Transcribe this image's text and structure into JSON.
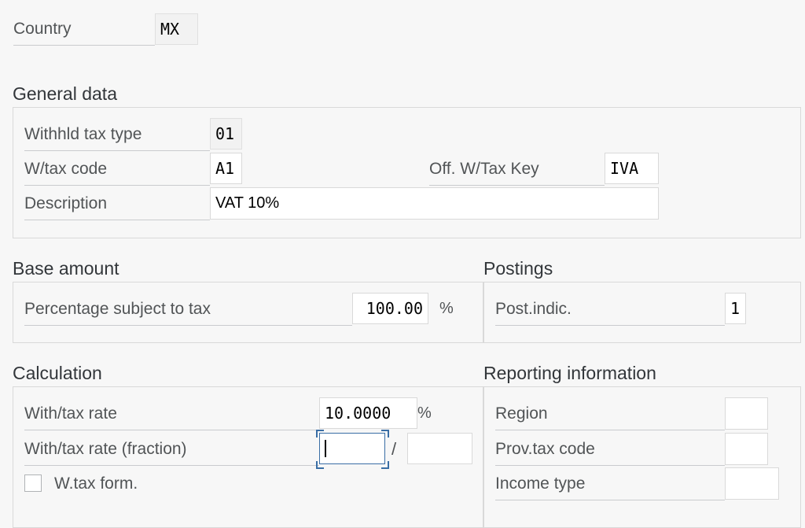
{
  "country": {
    "label": "Country",
    "value": "MX"
  },
  "general": {
    "title": "General data",
    "withhld_tax_type": {
      "label": "Withhld tax type",
      "value": "01"
    },
    "wtax_code": {
      "label": "W/tax code",
      "value": "A1"
    },
    "off_wtax_key": {
      "label": "Off. W/Tax Key",
      "value": "IVA"
    },
    "description": {
      "label": "Description",
      "value": "VAT 10%"
    }
  },
  "base_amount": {
    "title": "Base amount",
    "pct_subject": {
      "label": "Percentage subject to tax",
      "value": "100.00",
      "unit": "%"
    }
  },
  "postings": {
    "title": "Postings",
    "post_indic": {
      "label": "Post.indic.",
      "value": "1"
    }
  },
  "calculation": {
    "title": "Calculation",
    "wtax_rate": {
      "label": "With/tax rate",
      "value": "10.0000",
      "unit": "%"
    },
    "wtax_rate_fraction": {
      "label": "With/tax rate (fraction)",
      "numerator": "",
      "separator": "/",
      "denominator": ""
    },
    "wtax_form": {
      "label": "W.tax form.",
      "checked": false
    }
  },
  "reporting": {
    "title": "Reporting information",
    "region": {
      "label": "Region",
      "value": ""
    },
    "prov_tax_code": {
      "label": "Prov.tax code",
      "value": ""
    },
    "income_type": {
      "label": "Income type",
      "value": ""
    }
  },
  "colors": {
    "background": "#f7f7f7",
    "focus": "#3a6ea5",
    "border": "#d9d9d9"
  }
}
